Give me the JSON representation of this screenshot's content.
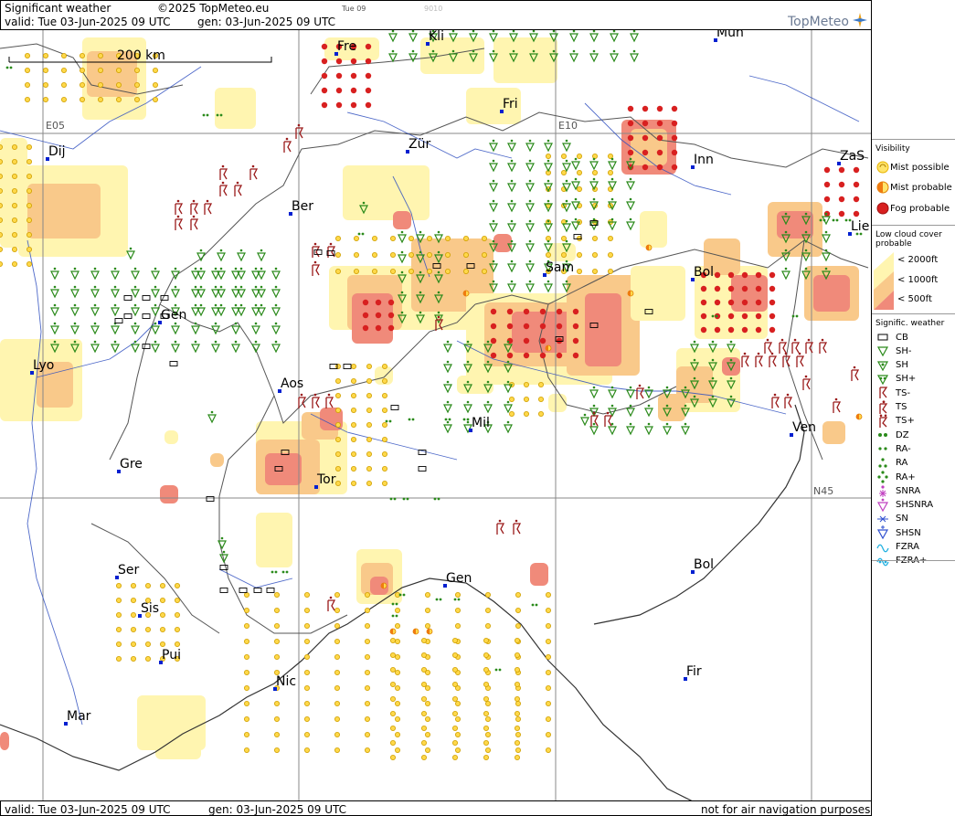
{
  "header": {
    "title": "Significant weather",
    "copyright": "©2025 TopMeteo.eu",
    "time_tab": "Tue 09",
    "faint_num": "9010",
    "valid_line": "valid:  Tue  03-Jun-2025  09 UTC",
    "gen_line": "gen:  03-Jun-2025 09 UTC",
    "logo": "TopMeteo"
  },
  "footer": {
    "valid_line": "valid:  Tue  03-Jun-2025  09 UTC",
    "gen_line": "gen:  03-Jun-2025 09 UTC",
    "disclaimer": "not for air navigation purposes"
  },
  "map": {
    "scale_label": "200 km",
    "grid_labels": [
      "E05",
      "E10",
      "N45"
    ],
    "cities": [
      "Fre",
      "Kli",
      "Mun",
      "Fri",
      "Zür",
      "Dij",
      "Inn",
      "ZaS",
      "Ber",
      "Lie",
      "Sam",
      "Bol",
      "Gen",
      "Lyo",
      "Aos",
      "Mil",
      "Ven",
      "Gre",
      "Tor",
      "Gen",
      "Bol",
      "Ser",
      "Sis",
      "Pui",
      "Nic",
      "Fir",
      "Mar"
    ],
    "colors": {
      "mist": "#fff5b0",
      "fog_light": "#ffe9a0",
      "fog_mid": "#f9c98a",
      "fog_red": "#f08a7a",
      "shower": "#2a8a1a",
      "thunder": "#9a1a1a",
      "rivers": "#3050c0"
    }
  },
  "legend": {
    "visibility_title": "Visibility",
    "vis_items": [
      {
        "label": "Mist possible",
        "icon": "mist-possible-icon"
      },
      {
        "label": "Mist probable",
        "icon": "mist-probable-icon"
      },
      {
        "label": "Fog probable",
        "icon": "fog-probable-icon"
      }
    ],
    "cloud_title": "Low cloud cover probable",
    "cloud_items": [
      {
        "label": "< 2000ft",
        "color": "#fff5b0"
      },
      {
        "label": "< 1000ft",
        "color": "#f9c98a"
      },
      {
        "label": "<   500ft",
        "color": "#f08a7a"
      }
    ],
    "sigwx_title": "Signific. weather",
    "sigwx_items": [
      {
        "label": "CB",
        "icon": "cb-icon"
      },
      {
        "label": "SH-",
        "icon": "shower-light-icon"
      },
      {
        "label": "SH",
        "icon": "shower-icon"
      },
      {
        "label": "SH+",
        "icon": "shower-heavy-icon"
      },
      {
        "label": "TS-",
        "icon": "thunderstorm-light-icon"
      },
      {
        "label": "TS",
        "icon": "thunderstorm-icon"
      },
      {
        "label": "TS+",
        "icon": "thunderstorm-heavy-icon"
      },
      {
        "label": "DZ",
        "icon": "drizzle-icon"
      },
      {
        "label": "RA-",
        "icon": "rain-light-icon"
      },
      {
        "label": "RA",
        "icon": "rain-icon"
      },
      {
        "label": "RA+",
        "icon": "rain-heavy-icon"
      },
      {
        "label": "SNRA",
        "icon": "snow-rain-icon"
      },
      {
        "label": "SHSNRA",
        "icon": "shower-snow-rain-icon"
      },
      {
        "label": "SN",
        "icon": "snow-icon"
      },
      {
        "label": "SHSN",
        "icon": "shower-snow-icon"
      },
      {
        "label": "FZRA",
        "icon": "freezing-rain-icon"
      },
      {
        "label": "FZRA+",
        "icon": "freezing-rain-heavy-icon"
      }
    ]
  }
}
